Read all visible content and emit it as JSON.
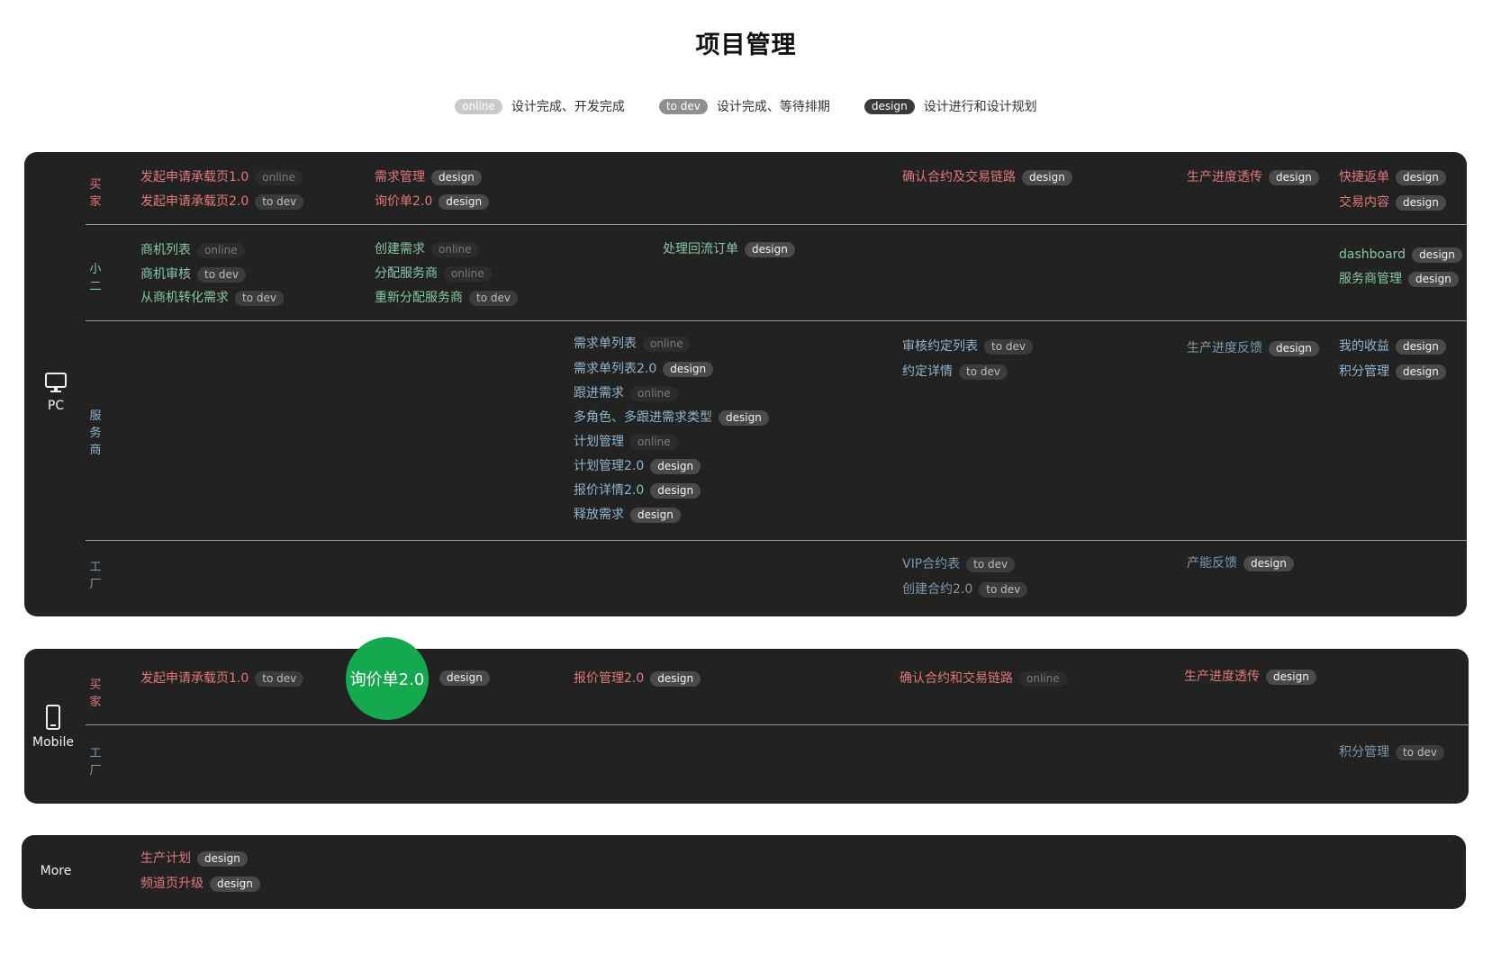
{
  "title": "项目管理",
  "legend": [
    {
      "badge": "online",
      "text": "设计完成、开发完成"
    },
    {
      "badge": "to dev",
      "text": "设计完成、等待排期"
    },
    {
      "badge": "design",
      "text": "设计进行和设计规划"
    }
  ],
  "pc": {
    "label": "PC",
    "icon": "desktop-icon",
    "roles": {
      "buyer": "买家",
      "staff": "小二",
      "provider": "服务商",
      "factory": "工厂"
    },
    "items": [
      {
        "text": "发起申请承载页1.0",
        "status": "online"
      },
      {
        "text": "发起申请承载页2.0",
        "status": "to dev"
      },
      {
        "text": "需求管理",
        "status": "design"
      },
      {
        "text": "询价单2.0",
        "status": "design"
      },
      {
        "text": "确认合约及交易链路",
        "status": "design"
      },
      {
        "text": "生产进度透传",
        "status": "design"
      },
      {
        "text": "快捷返单",
        "status": "design"
      },
      {
        "text": "交易内容",
        "status": "design"
      },
      {
        "text": "商机列表",
        "status": "online"
      },
      {
        "text": "商机审核",
        "status": "to dev"
      },
      {
        "text": "从商机转化需求",
        "status": "to dev"
      },
      {
        "text": "创建需求",
        "status": "online"
      },
      {
        "text": "分配服务商",
        "status": "online"
      },
      {
        "text": "重新分配服务商",
        "status": "to dev"
      },
      {
        "text": "处理回流订单",
        "status": "design"
      },
      {
        "text": "dashboard",
        "status": "design"
      },
      {
        "text": "服务商管理",
        "status": "design"
      },
      {
        "text": "需求单列表",
        "status": "online"
      },
      {
        "text": "需求单列表2.0",
        "status": "design"
      },
      {
        "text": "跟进需求",
        "status": "online"
      },
      {
        "text": "多角色、多跟进需求类型",
        "status": "design"
      },
      {
        "text": "计划管理",
        "status": "online"
      },
      {
        "text": "计划管理2.0",
        "status": "design"
      },
      {
        "text": "报价详情2.0",
        "status": "design"
      },
      {
        "text": "释放需求",
        "status": "design"
      },
      {
        "text": "审核约定列表",
        "status": "to dev"
      },
      {
        "text": "约定详情",
        "status": "to dev"
      },
      {
        "text": "生产进度反馈",
        "status": "design"
      },
      {
        "text": "我的收益",
        "status": "design"
      },
      {
        "text": "积分管理",
        "status": "design"
      },
      {
        "text": "VIP合约表",
        "status": "to dev"
      },
      {
        "text": "创建合约2.0",
        "status": "to dev"
      },
      {
        "text": "产能反馈",
        "status": "design"
      }
    ]
  },
  "mobile": {
    "label": "Mobile",
    "icon": "mobile-icon",
    "roles": {
      "buyer": "买家",
      "factory": "工厂"
    },
    "items": [
      {
        "text": "发起申请承载页1.0",
        "status": "to dev"
      },
      {
        "text": "询价单2.0",
        "status": "design"
      },
      {
        "text": "报价管理2.0",
        "status": "design"
      },
      {
        "text": "确认合约和交易链路",
        "status": "online"
      },
      {
        "text": "生产进度透传",
        "status": "design"
      },
      {
        "text": "积分管理",
        "status": "to dev"
      }
    ],
    "highlight": "询价单2.0"
  },
  "more": {
    "label": "More",
    "items": [
      {
        "text": "生产计划",
        "status": "design"
      },
      {
        "text": "频道页升级",
        "status": "design"
      }
    ]
  },
  "colors": {
    "panel": "#222222",
    "buyer": "#e1787a",
    "staff": "#86c7a4",
    "provider": "#8fb6cf",
    "factory": "#7d98aa",
    "highlight": "#14a84f"
  }
}
